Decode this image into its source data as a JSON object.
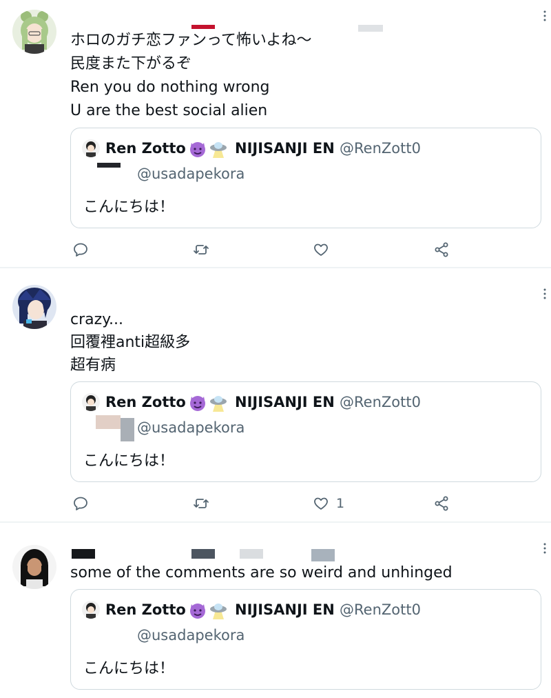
{
  "tweets": [
    {
      "lines": [
        "ホロのガチ恋ファンって怖いよね〜",
        "民度また下がるぞ",
        "Ren you do nothing wrong",
        "U are the best social alien"
      ],
      "quote": {
        "name": "Ren Zotto",
        "org": "NIJISANJI EN",
        "handle": "@RenZott0",
        "reply_handle": "@usadapekora",
        "body": "こんにちは！"
      },
      "like_count": ""
    },
    {
      "lines": [
        "crazy...",
        "回覆裡anti超級多",
        "超有病"
      ],
      "quote": {
        "name": "Ren Zotto",
        "org": "NIJISANJI EN",
        "handle": "@RenZott0",
        "reply_handle": "@usadapekora",
        "body": "こんにちは！"
      },
      "like_count": "1"
    },
    {
      "lines": [
        "some of the comments are so weird and unhinged"
      ],
      "quote": {
        "name": "Ren Zotto",
        "org": "NIJISANJI EN",
        "handle": "@RenZott0",
        "reply_handle": "@usadapekora",
        "body": "こんにちは！"
      },
      "like_count": ""
    }
  ],
  "icons": {
    "reply": "reply-icon",
    "retweet": "retweet-icon",
    "like": "heart-icon",
    "share": "share-icon",
    "more": "more-icon"
  },
  "colors": {
    "text": "#0f1419",
    "secondary": "#536471",
    "border": "#cfd9de",
    "divider": "#eff3f4"
  }
}
